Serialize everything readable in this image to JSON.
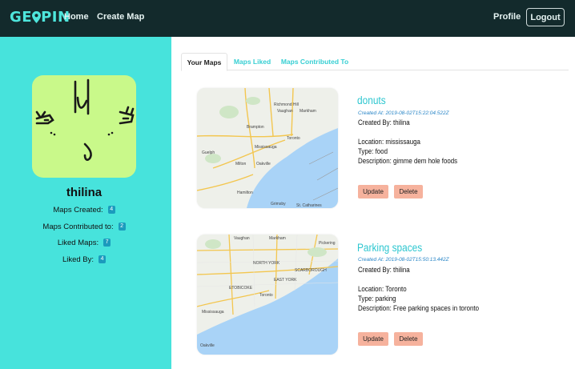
{
  "navbar": {
    "logo_prefix": "GE",
    "logo_suffix": "PIN",
    "home_label": "Home",
    "create_map_label": "Create Map",
    "profile_label": "Profile",
    "logout_label": "Logout"
  },
  "profile": {
    "username": "thilina",
    "stats": [
      {
        "label": "Maps Created:",
        "value": "4"
      },
      {
        "label": "Maps Contributed to:",
        "value": "2"
      },
      {
        "label": "Liked Maps:",
        "value": "7"
      },
      {
        "label": "Liked By:",
        "value": "4"
      }
    ]
  },
  "tabs": {
    "your_maps": "Your Maps",
    "maps_liked": "Maps Liked",
    "maps_contributed": "Maps Contributed To"
  },
  "maps": [
    {
      "title": "donuts",
      "created_at": "Created At: 2019-08-02T15:22:04.522Z",
      "created_by": "Created By: thilina",
      "location": "Location: mississauga",
      "type": "Type: food",
      "description": "Description: gimme dem hole foods",
      "update_label": "Update",
      "delete_label": "Delete",
      "map_labels": [
        "Richmond Hill",
        "Vaughan",
        "Markham",
        "Brampton",
        "Toronto",
        "Mississauga",
        "Guelph",
        "Milton",
        "Oakville",
        "Hamilton",
        "St. Catharines",
        "Grimsby"
      ]
    },
    {
      "title": "Parking spaces",
      "created_at": "Created At: 2019-08-02T15:50:13.442Z",
      "created_by": "Created By: thilina",
      "location": "Location: Toronto",
      "type": "Type: parking",
      "description": "Description: Free parking spaces in toronto",
      "update_label": "Update",
      "delete_label": "Delete",
      "map_labels": [
        "Vaughan",
        "Markham",
        "Pickering",
        "NORTH YORK",
        "SCARBOROUGH",
        "EAST YORK",
        "Toronto",
        "Mississauga",
        "Oakville",
        "ETOBICOKE"
      ]
    }
  ],
  "colors": {
    "navbar": "#132a2c",
    "sidebar": "#47e3dc",
    "accent": "#2ec7d0",
    "button": "#f6b29d",
    "badge": "#1b9bbd",
    "avatar_bg": "#c9f98a"
  }
}
